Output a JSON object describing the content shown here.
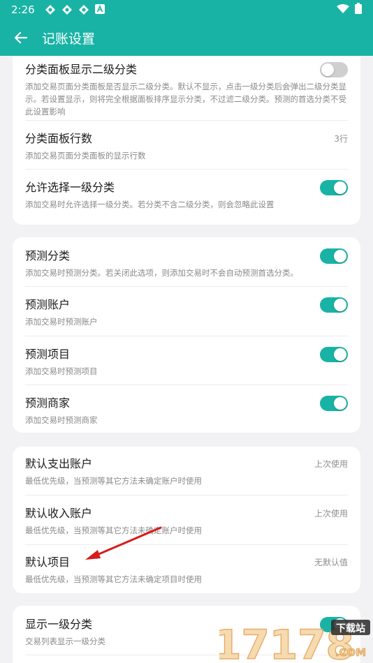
{
  "status_bar": {
    "time": "2:26",
    "icons": [
      "cloud-sync-icon",
      "cloud-sync-icon",
      "cloud-sync-icon",
      "a-notification-icon"
    ],
    "right_icons": [
      "wifi-icon",
      "battery-icon"
    ]
  },
  "app_bar": {
    "title": "记账设置",
    "back_icon": "back-arrow-icon"
  },
  "colors": {
    "accent": "#19b3a6",
    "background": "#f2f2f4",
    "toggle_off": "#cfcfcf"
  },
  "cards": [
    {
      "items": [
        {
          "title": "分类面板显示二级分类",
          "desc": "添加交易页面分类面板是否显示二级分类。默认不显示，点击一级分类后会弹出二级分类显示。若设置显示，则将完全根据面板排序显示分类，不过滤二级分类。预测的首选分类不受此设置影响",
          "control": "toggle",
          "on": false
        },
        {
          "title": "分类面板行数",
          "desc": "添加交易页面分类面板的显示行数",
          "control": "value",
          "value": "3行"
        },
        {
          "title": "允许选择一级分类",
          "desc": "添加交易时允许选择一级分类。若分类不含二级分类，则会忽略此设置",
          "control": "toggle",
          "on": true
        }
      ]
    },
    {
      "items": [
        {
          "title": "预测分类",
          "desc": "添加交易时预测分类。若关闭此选项，则添加交易时不会自动预测首选分类。",
          "control": "toggle",
          "on": true
        },
        {
          "title": "预测账户",
          "desc": "添加交易时预测账户",
          "control": "toggle",
          "on": true
        },
        {
          "title": "预测项目",
          "desc": "添加交易时预测项目",
          "control": "toggle",
          "on": true
        },
        {
          "title": "预测商家",
          "desc": "添加交易时预测商家",
          "control": "toggle",
          "on": true
        }
      ]
    },
    {
      "items": [
        {
          "title": "默认支出账户",
          "desc": "最低优先级，当预测等其它方法未确定账户时使用",
          "control": "value",
          "value": "上次使用"
        },
        {
          "title": "默认收入账户",
          "desc": "最低优先级，当预测等其它方法未确定账户时使用",
          "control": "value",
          "value": "上次使用"
        },
        {
          "title": "默认项目",
          "desc": "最低优先级，当预测等其它方法未确定项目时使用",
          "control": "value",
          "value": "无默认值"
        }
      ]
    },
    {
      "items": [
        {
          "title": "显示一级分类",
          "desc": "交易列表显示一级分类",
          "control": "toggle",
          "on": true
        }
      ]
    }
  ],
  "watermark": {
    "text": "17178",
    "badge": "下载站",
    "domain": ".COM"
  }
}
